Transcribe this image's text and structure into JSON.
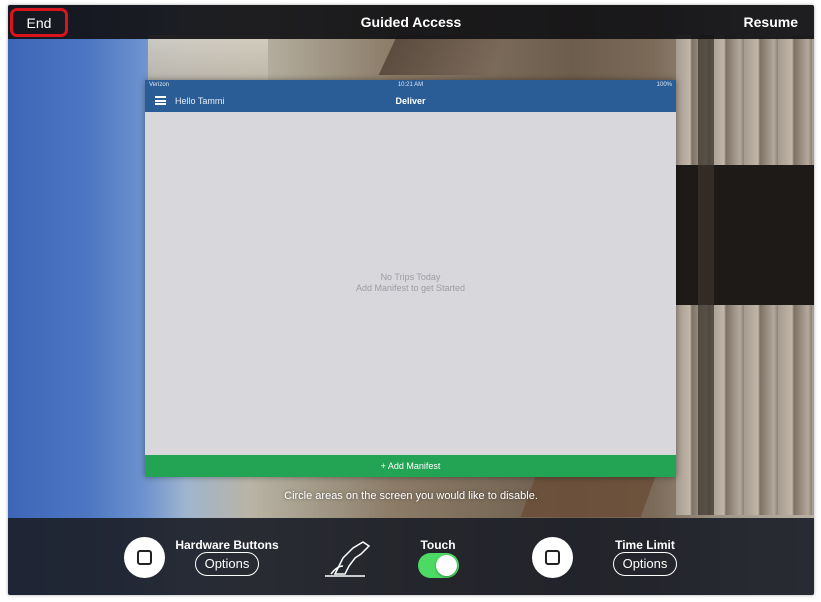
{
  "topbar": {
    "end_label": "End",
    "title": "Guided Access",
    "resume_label": "Resume"
  },
  "app": {
    "status": {
      "carrier": "Verizon",
      "time": "10:21 AM",
      "battery": "100%"
    },
    "nav": {
      "greeting": "Hello Tammi",
      "title": "Deliver"
    },
    "empty_state": {
      "line1": "No Trips Today",
      "line2": "Add Manifest to get Started"
    },
    "add_manifest_label": "+ Add Manifest"
  },
  "hint": "Circle areas on the screen you would like to disable.",
  "options": {
    "hardware": {
      "label": "Hardware Buttons",
      "button": "Options",
      "icon": "square-icon",
      "enabled": false
    },
    "touch": {
      "label": "Touch",
      "icon": "hand-touch-icon",
      "enabled": true
    },
    "time_limit": {
      "label": "Time Limit",
      "button": "Options",
      "icon": "square-icon",
      "enabled": false
    }
  },
  "colors": {
    "highlight": "#d8141c",
    "app_nav": "#2a5d96",
    "add_manifest": "#23a455",
    "toggle_on": "#4cd964"
  }
}
